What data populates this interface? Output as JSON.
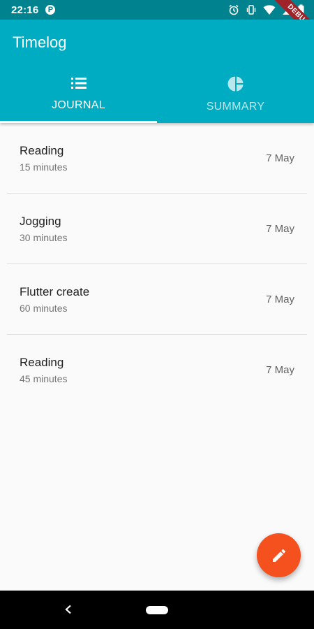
{
  "status_bar": {
    "time": "22:16",
    "p_badge": "P"
  },
  "debug_banner": {
    "label": "DEBUG"
  },
  "app_bar": {
    "title": "Timelog",
    "color": "#00acc1"
  },
  "tabs": [
    {
      "label": "JOURNAL",
      "icon": "list-icon",
      "active": true
    },
    {
      "label": "SUMMARY",
      "icon": "pie-chart-icon",
      "active": false
    }
  ],
  "entries": [
    {
      "title": "Reading",
      "duration": "15 minutes",
      "date": "7 May"
    },
    {
      "title": "Jogging",
      "duration": "30 minutes",
      "date": "7 May"
    },
    {
      "title": "Flutter create",
      "duration": "60 minutes",
      "date": "7 May"
    },
    {
      "title": "Reading",
      "duration": "45 minutes",
      "date": "7 May"
    }
  ],
  "fab": {
    "icon": "edit-icon",
    "color": "#f4511e"
  }
}
